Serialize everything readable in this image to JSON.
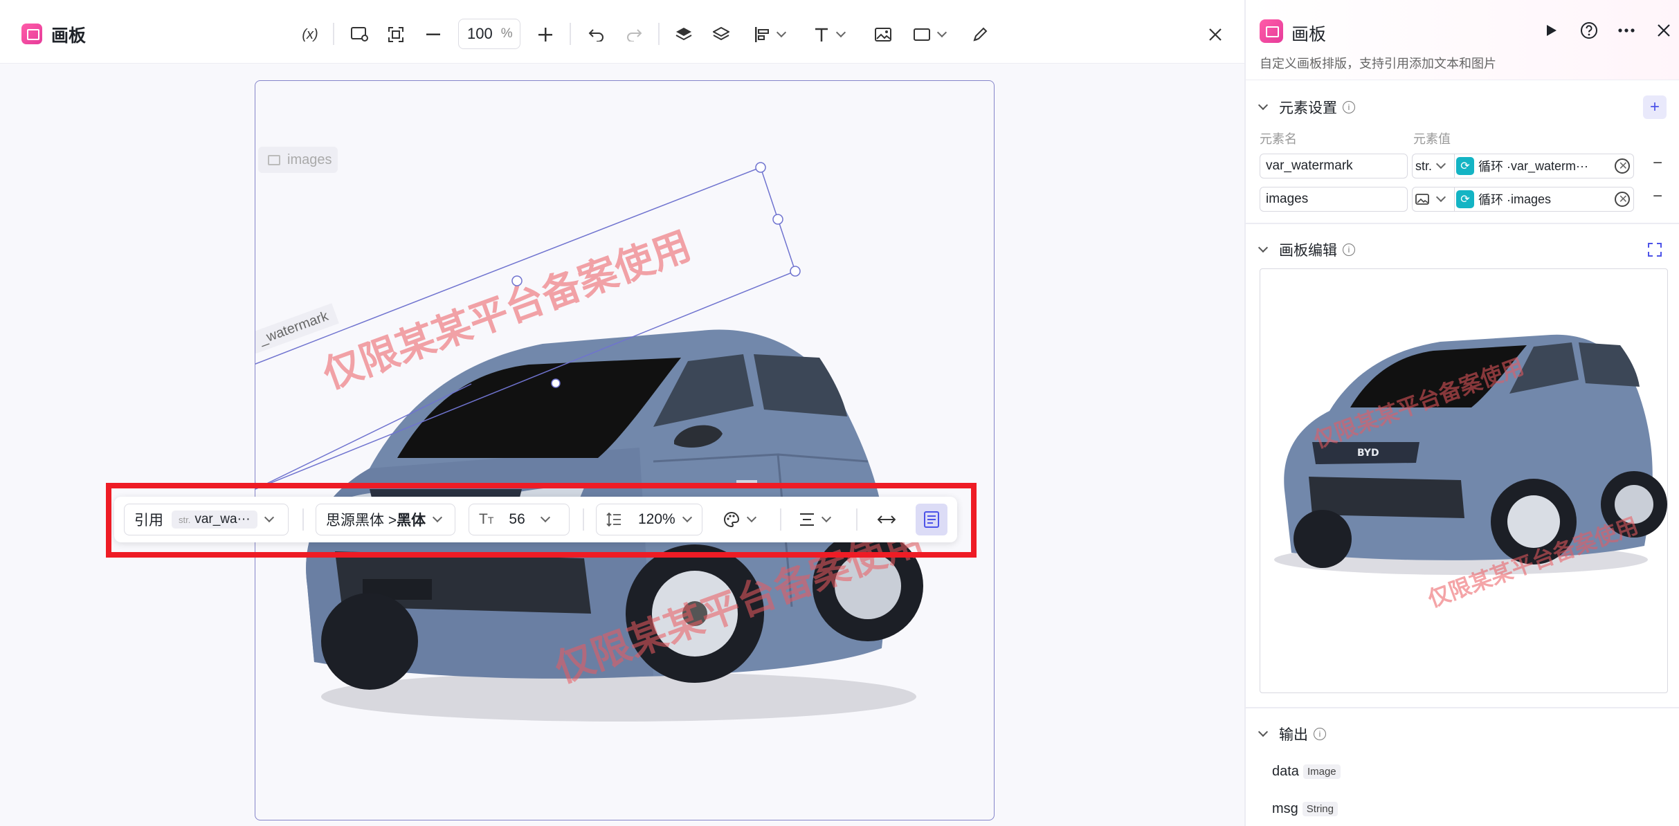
{
  "editor": {
    "title": "画板",
    "toolbar": {
      "variable_label": "(x)",
      "zoom_value": "100",
      "zoom_unit": "%"
    },
    "canvas": {
      "images_tag": "images",
      "selection_label": "_watermark",
      "watermark_text": "仅限某某平台备案使用",
      "car_badge": "BYD"
    },
    "float_toolbar": {
      "ref_label": "引用",
      "ref_type": "str.",
      "ref_value": "var_wa···",
      "font_family": "思源黑体 > ",
      "font_weight": "黑体",
      "font_size": "56",
      "line_height": "120%"
    }
  },
  "panel": {
    "title": "画板",
    "description": "自定义画板排版，支持引用添加文本和图片",
    "element_settings": {
      "title": "元素设置",
      "name_col": "元素名",
      "value_col": "元素值",
      "rows": [
        {
          "name": "var_watermark",
          "type": "str.",
          "loop": "循环 · ",
          "value": "var_waterm···"
        },
        {
          "name": "images",
          "type": "",
          "loop": "循环 · ",
          "value": "images"
        }
      ]
    },
    "canvas_edit": {
      "title": "画板编辑"
    },
    "output": {
      "title": "输出",
      "fields": [
        {
          "name": "data",
          "type": "Image"
        },
        {
          "name": "msg",
          "type": "String"
        }
      ]
    }
  },
  "colors": {
    "accent": "#4d53e8",
    "brand_pink": "#e63b9a",
    "watermark": "#eb5a5f",
    "highlight_red": "#ee1c25",
    "loop_teal": "#14b4c4"
  }
}
